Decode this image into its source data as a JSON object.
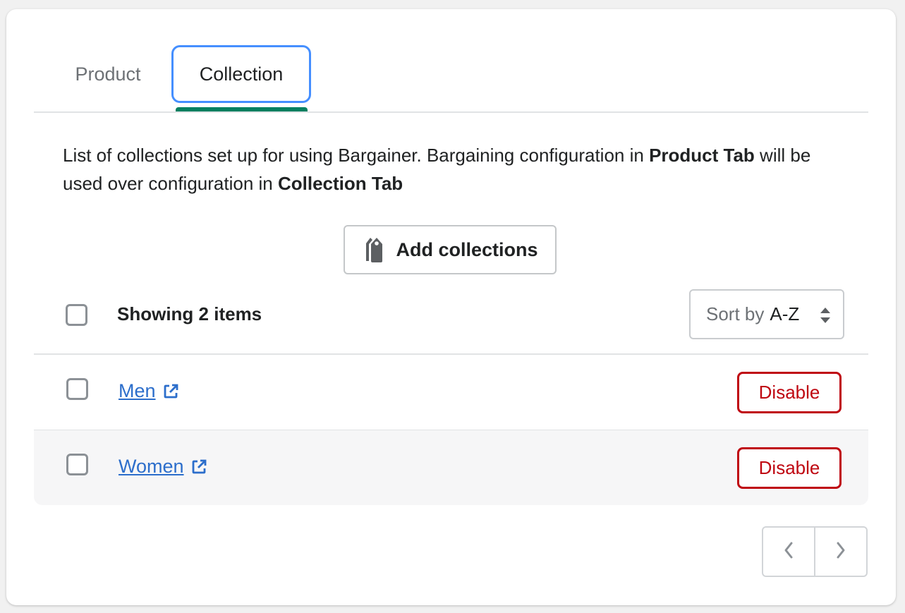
{
  "tabs": [
    {
      "label": "Product",
      "active": false
    },
    {
      "label": "Collection",
      "active": true
    }
  ],
  "description": {
    "part1": "List of collections set up for using Bargainer. Bargaining configuration in ",
    "bold1": "Product Tab",
    "part2": " will be used over configuration in ",
    "bold2": "Collection Tab"
  },
  "add_button": {
    "label": "Add collections",
    "icon": "tag-icon"
  },
  "list_header": {
    "showing_text": "Showing 2 items",
    "sort": {
      "label": "Sort by",
      "selected": "A-Z",
      "icon": "sort-arrows-icon"
    }
  },
  "items": [
    {
      "name": "Men",
      "action_label": "Disable",
      "icon": "external-link-icon"
    },
    {
      "name": "Women",
      "action_label": "Disable",
      "icon": "external-link-icon"
    }
  ],
  "pagination": {
    "prev_icon": "chevron-left-icon",
    "next_icon": "chevron-right-icon"
  },
  "colors": {
    "accent_green": "#008060",
    "focus_blue": "#458fff",
    "link_blue": "#2c6ecb",
    "critical_red": "#bf0711"
  }
}
